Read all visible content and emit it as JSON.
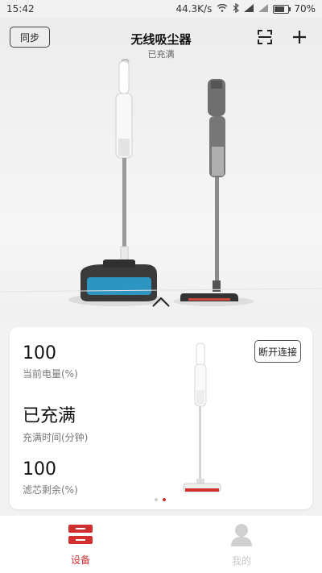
{
  "status_bar": {
    "time": "15:42",
    "network_speed": "44.3K/s",
    "battery_text": "70%",
    "battery_level": 0.7
  },
  "header": {
    "title": "无线吸尘器",
    "subtitle": "已充满",
    "sync_label": "同步",
    "scan_icon": "scan-icon",
    "add_icon": "plus-icon"
  },
  "stats": [
    {
      "value": "100",
      "label": "当前电量(%)"
    },
    {
      "value": "已充满",
      "label": "充满时间(分钟)"
    },
    {
      "value": "100",
      "label": "滤芯剩余(%)"
    }
  ],
  "card": {
    "disconnect_label": "断开连接",
    "page_count": 2,
    "active_page": 2
  },
  "bottom_nav": [
    {
      "label": "设备",
      "icon": "device-icon",
      "active": true,
      "color": "#d32f2f"
    },
    {
      "label": "我的",
      "icon": "user-icon",
      "active": false,
      "color": "#c8c8c8"
    }
  ],
  "colors": {
    "accent": "#d32f2f",
    "background": "#f2f2f2"
  }
}
